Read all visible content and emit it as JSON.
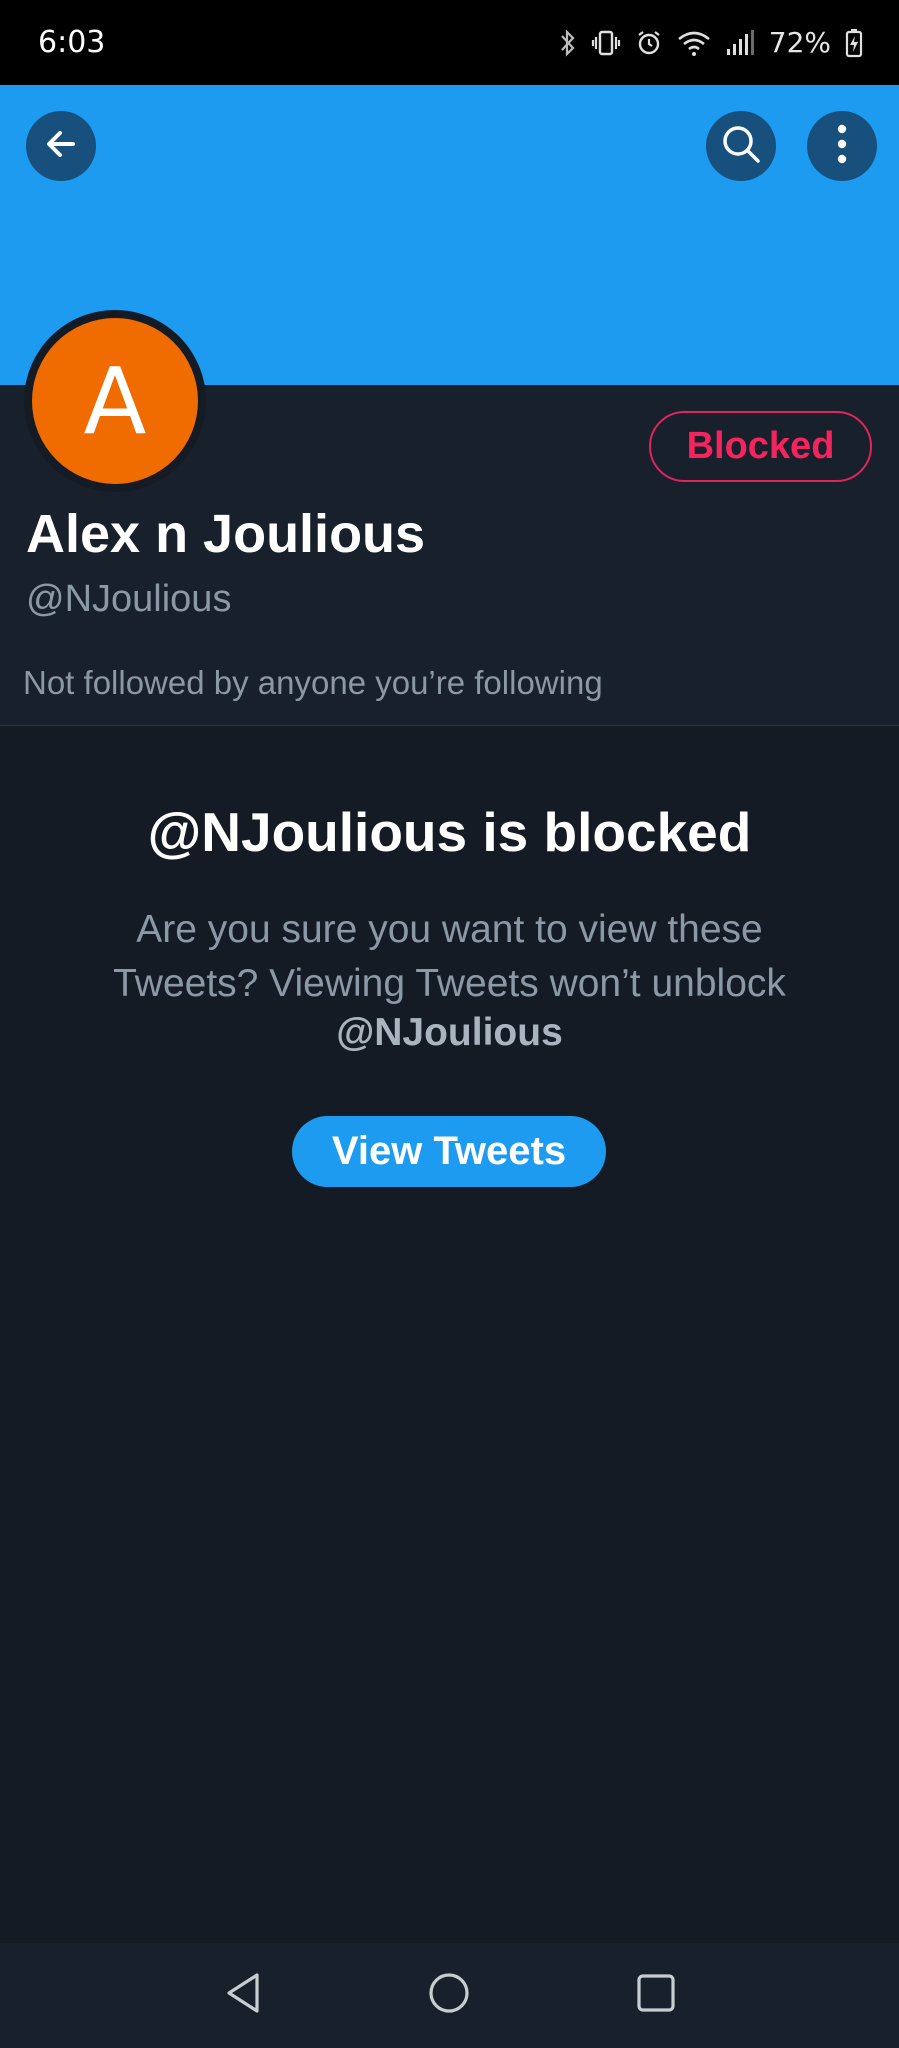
{
  "status_bar": {
    "time": "6:03",
    "battery": "72%",
    "icons": [
      "bluetooth-icon",
      "vibrate-icon",
      "alarm-icon",
      "wifi-icon",
      "signal-icon",
      "battery-charging-icon"
    ]
  },
  "header": {
    "back_icon": "arrow-left-icon",
    "search_icon": "search-icon",
    "more_icon": "more-vertical-icon",
    "banner_color": "#1d9bf0"
  },
  "profile": {
    "avatar_letter": "A",
    "avatar_color": "#f06b00",
    "blocked_label": "Blocked",
    "display_name": "Alex n Joulious",
    "handle": "@NJoulious",
    "followed_by": "Not followed by anyone you’re following"
  },
  "blocked_notice": {
    "title": "@NJoulious is blocked",
    "body": "Are you sure you want to view these Tweets? Viewing Tweets won’t unblock",
    "handle": "@NJoulious",
    "button_label": "View Tweets"
  },
  "nav_bar": {
    "icons": [
      "back-triangle-icon",
      "home-circle-icon",
      "recents-square-icon"
    ]
  }
}
